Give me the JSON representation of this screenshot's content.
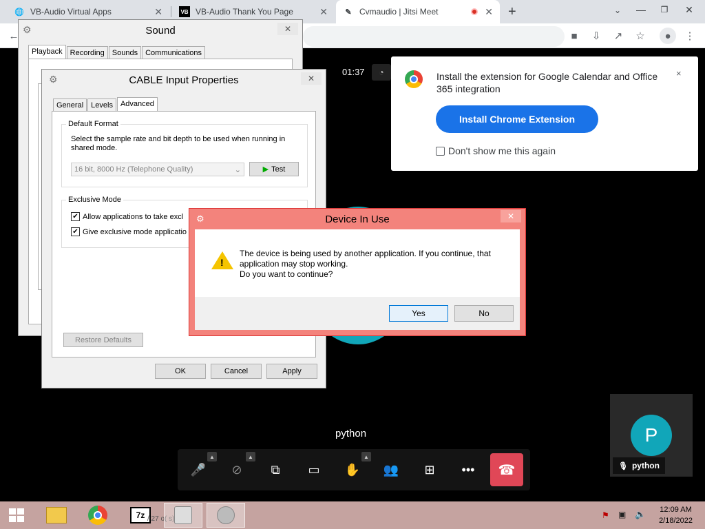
{
  "browser": {
    "tabs": [
      {
        "title": "VB-Audio Virtual Apps",
        "favicon": "globe-icon"
      },
      {
        "title": "VB-Audio Thank You Page",
        "favicon": "VB"
      },
      {
        "title": "Cvmaudio | Jitsi Meet",
        "favicon": "jitsi-icon",
        "recording": true
      }
    ],
    "new_tab": "+"
  },
  "jitsi": {
    "timer": "01:37",
    "participant_name": "python",
    "self_name": "python",
    "self_initial": "P",
    "colors": {
      "avatar": "#11a6b9",
      "hangup": "#e04757",
      "primary": "#1a73e8"
    }
  },
  "extension_prompt": {
    "text": "Install the extension for Google Calendar and Office 365 integration",
    "button": "Install Chrome Extension",
    "checkbox_label": "Don't show me this again",
    "close": "×"
  },
  "sound_dialog": {
    "title": "Sound",
    "tabs": [
      "Playback",
      "Recording",
      "Sounds",
      "Communications"
    ],
    "selected_tab": "Playback"
  },
  "cable_dialog": {
    "title": "CABLE Input Properties",
    "tabs": [
      "General",
      "Levels",
      "Advanced"
    ],
    "selected_tab": "Advanced",
    "default_format_legend": "Default Format",
    "default_format_desc": "Select the sample rate and bit depth to be used when running in shared mode.",
    "format_value": "16 bit, 8000 Hz (Telephone Quality)",
    "test_button": "Test",
    "exclusive_legend": "Exclusive Mode",
    "exclusive_opt1": "Allow applications to take excl",
    "exclusive_opt2": "Give exclusive mode applicatio",
    "restore_defaults": "Restore Defaults",
    "ok": "OK",
    "cancel": "Cancel",
    "apply": "Apply"
  },
  "device_dialog": {
    "title": "Device In Use",
    "message_line1": "The device is being used by another application.  If you continue, that",
    "message_line2": "application may stop working.",
    "message_line3": "Do you want to continue?",
    "yes": "Yes",
    "no": "No"
  },
  "taskbar": {
    "time": "12:09 AM",
    "date": "2/18/2022",
    "hidden_text": "/ 27 o(      s) sele"
  }
}
